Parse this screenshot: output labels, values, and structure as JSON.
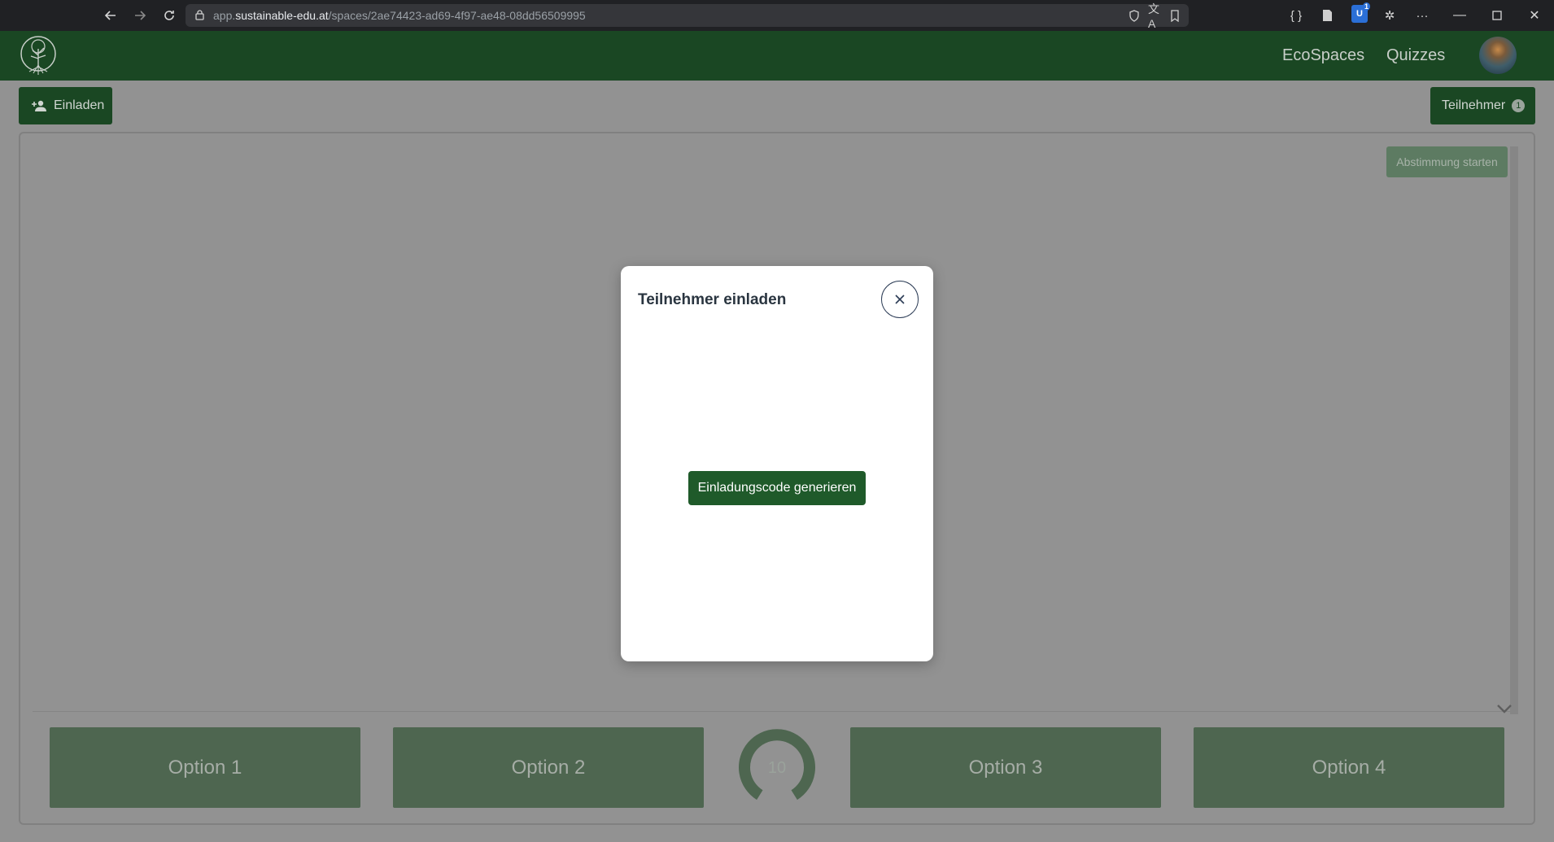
{
  "browser": {
    "url_prefix": "app.",
    "url_host": "sustainable-edu.at",
    "url_path": "/spaces/2ae74423-ad69-4f97-ae48-08dd56509995",
    "extension_badge_count": "1",
    "icons": [
      "back-icon",
      "forward-icon",
      "reload-icon",
      "lock-icon",
      "shield-icon",
      "translate-icon",
      "reading-list-icon",
      "devtools-icon",
      "page-icon",
      "extension-icon",
      "puzzle-icon",
      "more-icon",
      "minimize-icon",
      "maximize-icon",
      "close-icon"
    ]
  },
  "header": {
    "nav": [
      "EcoSpaces",
      "Quizzes"
    ],
    "brand_color": "#1a4723"
  },
  "toolbar": {
    "invite_label": "Einladen",
    "participants_label": "Teilnehmer",
    "participants_count": "1"
  },
  "main": {
    "start_vote_label": "Abstimmung starten",
    "options": [
      "Option 1",
      "Option 2",
      "Option 3",
      "Option 4"
    ],
    "timer_value": "10"
  },
  "modal": {
    "title": "Teilnehmer einladen",
    "generate_label": "Einladungscode generieren"
  }
}
